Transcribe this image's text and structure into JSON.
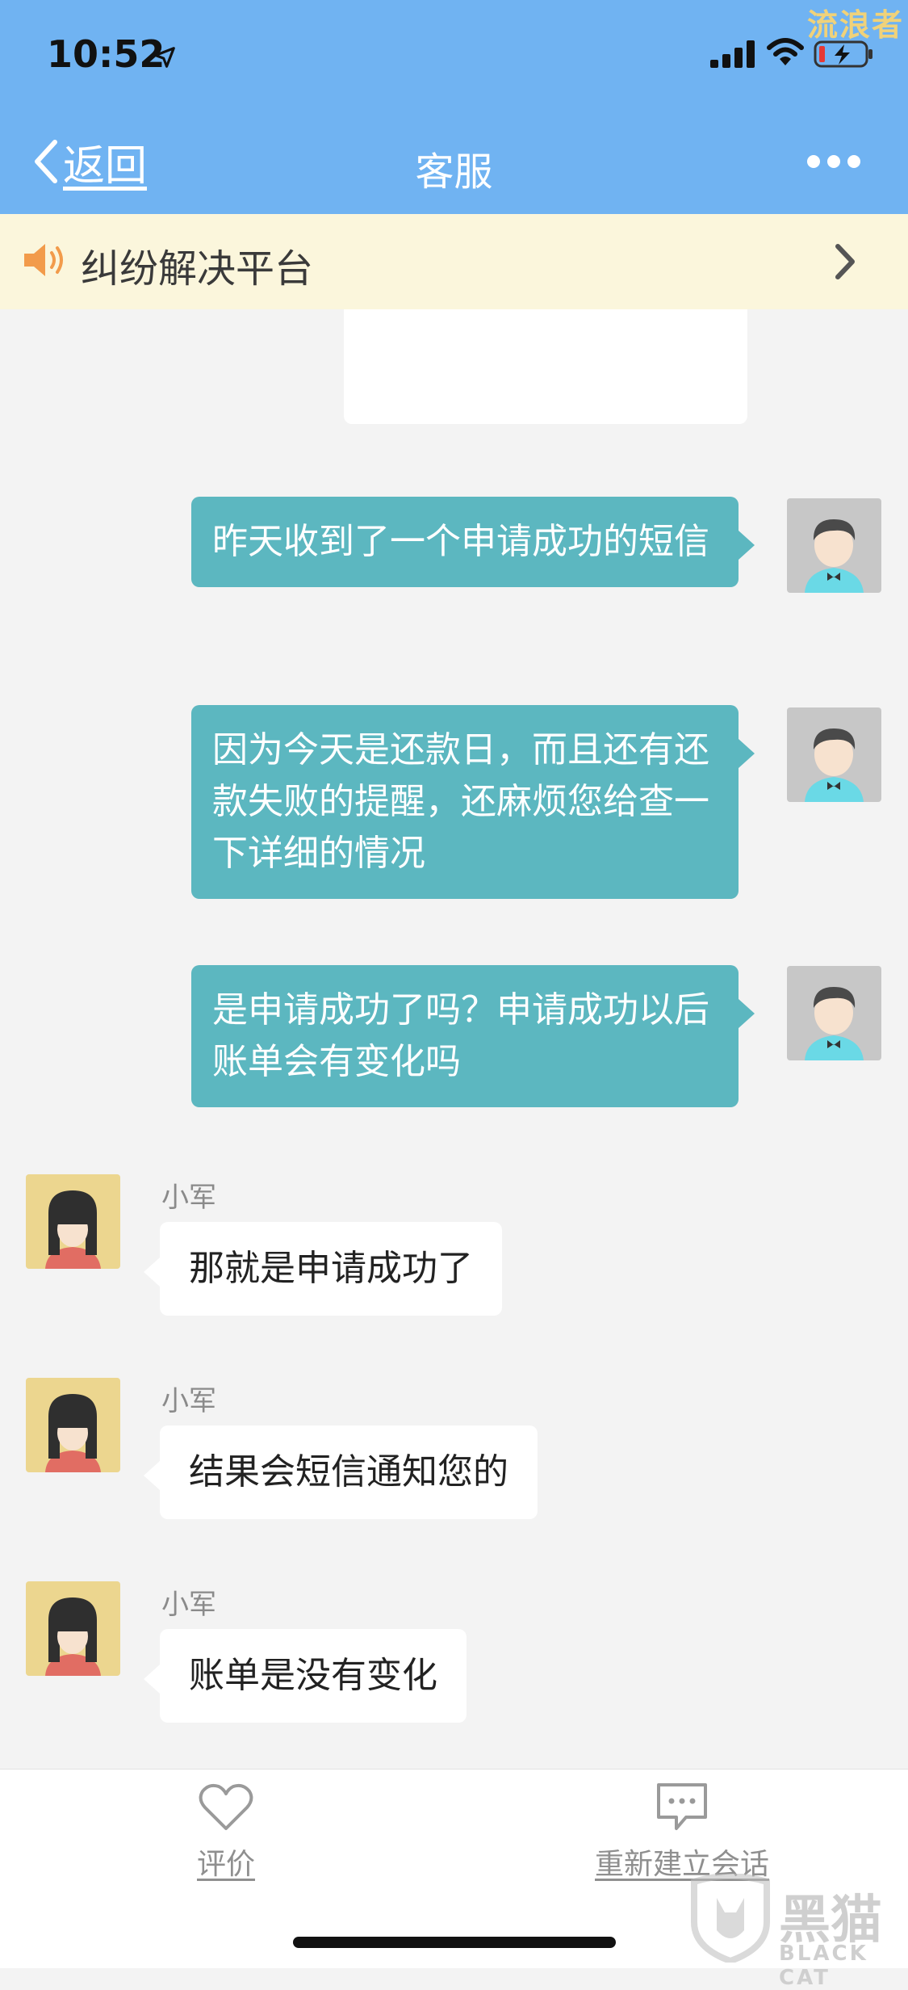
{
  "status_bar": {
    "time": "10:52"
  },
  "watermark": {
    "top_right": "流浪者",
    "brand": "黑猫",
    "brand_sub": "BLACK CAT"
  },
  "nav": {
    "back_label": "返回",
    "title": "客服"
  },
  "notice": {
    "text": "纠纷解决平台"
  },
  "messages_out": [
    {
      "text": "昨天收到了一个申请成功的短信"
    },
    {
      "text": "因为今天是还款日，而且还有还款失败的提醒，还麻烦您给查一下详细的情况"
    },
    {
      "text": "是申请成功了吗？申请成功以后账单会有变化吗"
    }
  ],
  "messages_in": [
    {
      "sender": "小军",
      "text": "那就是申请成功了"
    },
    {
      "sender": "小军",
      "text": "结果会短信通知您的"
    },
    {
      "sender": "小军",
      "text": "账单是没有变化"
    }
  ],
  "bottom_bar": {
    "rate_label": "评价",
    "new_session_label": "重新建立会话"
  },
  "colors": {
    "header": "#70b3f2",
    "bubble_out": "#5cb7c0",
    "notice_bg": "#fbf6dc"
  }
}
